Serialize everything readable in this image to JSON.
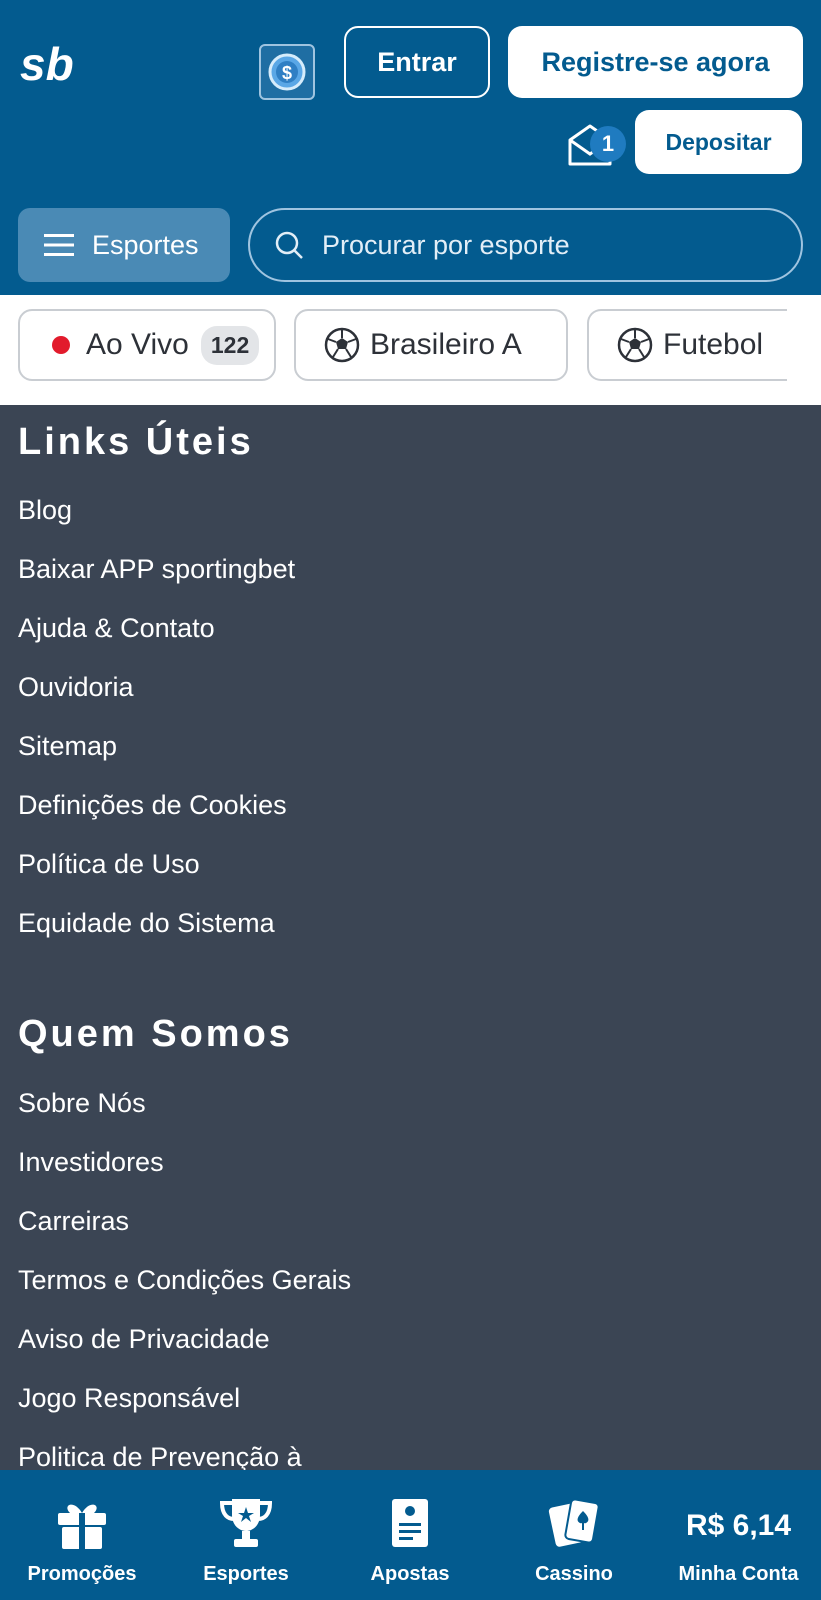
{
  "header": {
    "logo_text": "sb",
    "login_label": "Entrar",
    "register_label": "Registre-se agora",
    "deposit_label": "Depositar",
    "mail_count": "1",
    "sports_label": "Esportes",
    "search_placeholder": "Procurar por esporte"
  },
  "chips": [
    {
      "label": "Ao Vivo",
      "count": "122"
    },
    {
      "label": "Brasileiro A"
    },
    {
      "label": "Futebol"
    }
  ],
  "sections": [
    {
      "title": "Links Úteis",
      "links": [
        "Blog",
        "Baixar APP sportingbet",
        "Ajuda & Contato",
        "Ouvidoria",
        "Sitemap",
        "Definições de Cookies",
        "Política de Uso",
        "Equidade do Sistema"
      ]
    },
    {
      "title": "Quem Somos",
      "links": [
        "Sobre Nós",
        "Investidores",
        "Carreiras",
        "Termos e Condições Gerais",
        "Aviso de Privacidade",
        "Jogo Responsável",
        "Politica de Prevenção à"
      ]
    }
  ],
  "bottom_nav": {
    "promotions": "Promoções",
    "sports": "Esportes",
    "bets": "Apostas",
    "casino": "Cassino",
    "balance": "R$ 6,14",
    "account": "Minha Conta"
  },
  "colors": {
    "brand_blue": "#035b8f",
    "footer_bg": "#3b4554",
    "live_red": "#e21b2c"
  }
}
